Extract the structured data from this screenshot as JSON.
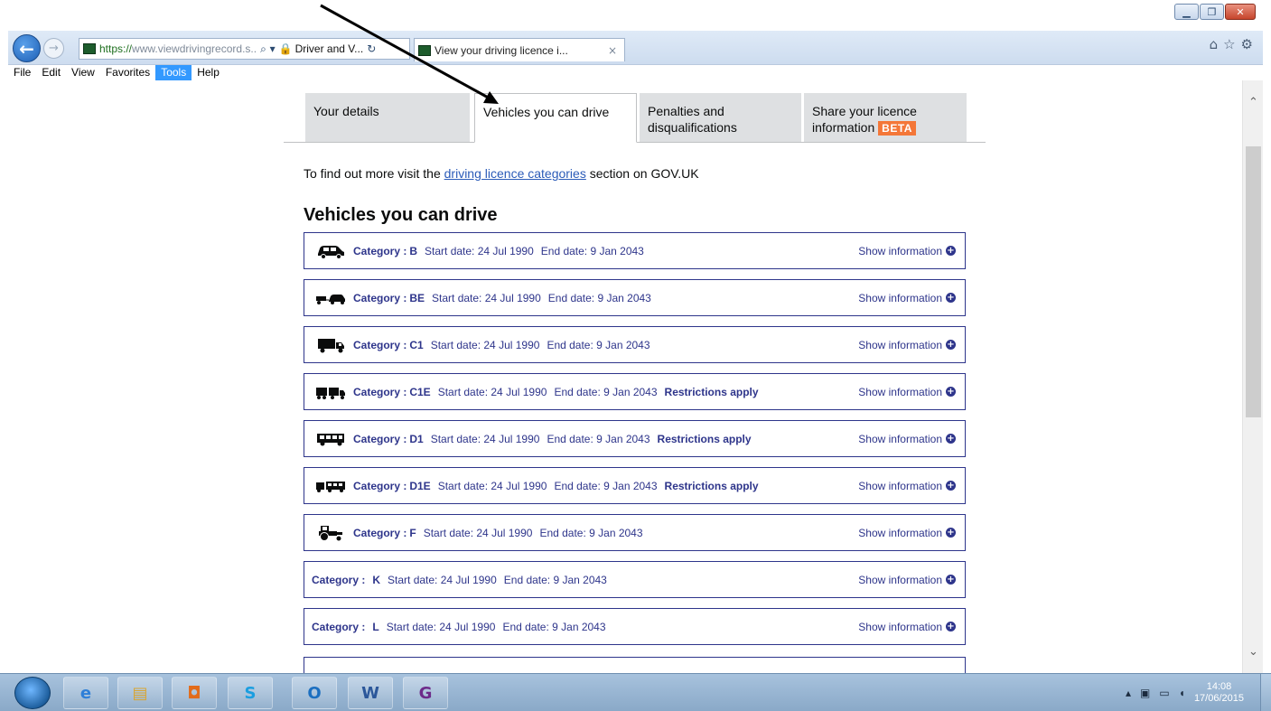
{
  "browser": {
    "url_host": "https://",
    "url_rest": "www.viewdrivingrecord.s..",
    "site_identity": "Driver and V...",
    "tab_title": "View your driving licence i...",
    "tab_close": "×",
    "menu": [
      "File",
      "Edit",
      "View",
      "Favorites",
      "Tools",
      "Help"
    ],
    "active_menu": "Tools",
    "window_buttons": {
      "minimize": "▁",
      "maximize": "❐",
      "close": "✕"
    }
  },
  "page": {
    "tabs": [
      {
        "line1": "Your details",
        "line2": ""
      },
      {
        "line1": "Vehicles you can drive",
        "line2": ""
      },
      {
        "line1": "Penalties and",
        "line2": "disqualifications"
      },
      {
        "line1": "Share your licence",
        "line2": "information",
        "badge": "BETA"
      }
    ],
    "active_tab": "Vehicles you can drive",
    "intro_prefix": "To find out more visit the ",
    "intro_link": "driving licence categories",
    "intro_suffix": " section on GOV.UK",
    "heading": "Vehicles you can drive",
    "category_label": "Category :",
    "show_information": "Show information",
    "categories": [
      {
        "code": "B",
        "icon": "car-icon",
        "start": "Start date: 24 Jul 1990",
        "end": "End date: 9 Jan 2043",
        "restriction": ""
      },
      {
        "code": "BE",
        "icon": "car-trailer-icon",
        "start": "Start date: 24 Jul 1990",
        "end": "End date: 9 Jan 2043",
        "restriction": ""
      },
      {
        "code": "C1",
        "icon": "lorry-icon",
        "start": "Start date: 24 Jul 1990",
        "end": "End date: 9 Jan 2043",
        "restriction": ""
      },
      {
        "code": "C1E",
        "icon": "lorry-trailer-icon",
        "start": "Start date: 24 Jul 1990",
        "end": "End date: 9 Jan 2043",
        "restriction": "Restrictions apply"
      },
      {
        "code": "D1",
        "icon": "minibus-icon",
        "start": "Start date: 24 Jul 1990",
        "end": "End date: 9 Jan 2043",
        "restriction": "Restrictions apply"
      },
      {
        "code": "D1E",
        "icon": "minibus-trailer-icon",
        "start": "Start date: 24 Jul 1990",
        "end": "End date: 9 Jan 2043",
        "restriction": "Restrictions apply"
      },
      {
        "code": "F",
        "icon": "tractor-icon",
        "start": "Start date: 24 Jul 1990",
        "end": "End date: 9 Jan 2043",
        "restriction": ""
      },
      {
        "code": "K",
        "icon": "",
        "start": "Start date: 24 Jul 1990",
        "end": "End date: 9 Jan 2043",
        "restriction": ""
      },
      {
        "code": "L",
        "icon": "",
        "start": "Start date: 24 Jul 1990",
        "end": "End date: 9 Jan 2043",
        "restriction": ""
      }
    ]
  },
  "taskbar": {
    "time": "14:08",
    "date": "17/06/2015",
    "pinned": [
      "internet-explorer-icon",
      "file-explorer-icon",
      "media-player-icon",
      "skype-icon",
      "outlook-icon",
      "word-icon",
      "pdf-creator-icon"
    ]
  },
  "colors": {
    "link": "#2b5bb8",
    "category_border": "#2e358b",
    "beta_badge": "#f47738",
    "tab_inactive": "#dee0e2",
    "menu_highlight": "#3399ff"
  }
}
